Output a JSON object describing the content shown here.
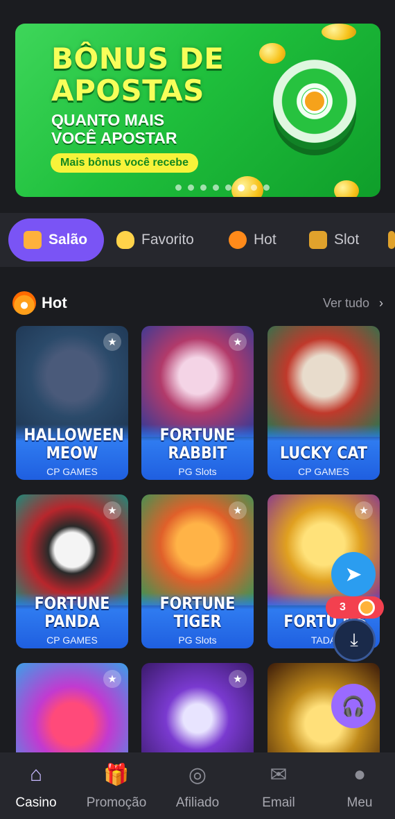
{
  "banner": {
    "title_line1": "BÔNUS DE",
    "title_line2": "APOSTAS",
    "sub_line1": "QUANTO MAIS",
    "sub_line2": "VOCÊ APOSTAR",
    "pill": "Mais bônus você recebe",
    "dots": 8,
    "active_dot": 6
  },
  "tabs": [
    {
      "label": "Salão",
      "icon": "gamepad-icon",
      "active": true
    },
    {
      "label": "Favorito",
      "icon": "heart-icon",
      "active": false
    },
    {
      "label": "Hot",
      "icon": "flame-icon",
      "active": false
    },
    {
      "label": "Slot",
      "icon": "slot-machine-icon",
      "active": false
    }
  ],
  "section": {
    "title": "Hot",
    "see_all": "Ver tudo"
  },
  "games": [
    {
      "name": "HALLOWEEN MEOW",
      "provider": "CP GAMES"
    },
    {
      "name": "FORTUNE RABBIT",
      "provider": "PG Slots"
    },
    {
      "name": "LUCKY CAT",
      "provider": "CP GAMES"
    },
    {
      "name": "FORTUNE PANDA",
      "provider": "CP GAMES"
    },
    {
      "name": "FORTUNE TIGER",
      "provider": "PG Slots"
    },
    {
      "name": "FORTU MS",
      "provider": "TADA"
    }
  ],
  "floating": {
    "badge_count": "3"
  },
  "bottom_nav": [
    {
      "label": "Casino",
      "icon": "home-icon",
      "active": true
    },
    {
      "label": "Promoção",
      "icon": "gift-icon",
      "active": false
    },
    {
      "label": "Afiliado",
      "icon": "affiliate-icon",
      "active": false
    },
    {
      "label": "Email",
      "icon": "mail-icon",
      "active": false
    },
    {
      "label": "Meu",
      "icon": "user-icon",
      "active": false
    }
  ],
  "colors": {
    "accent": "#7a54f5",
    "background": "#1b1c20",
    "banner_green": "#1fbf3c",
    "card_blue": "#2f7bf0"
  }
}
